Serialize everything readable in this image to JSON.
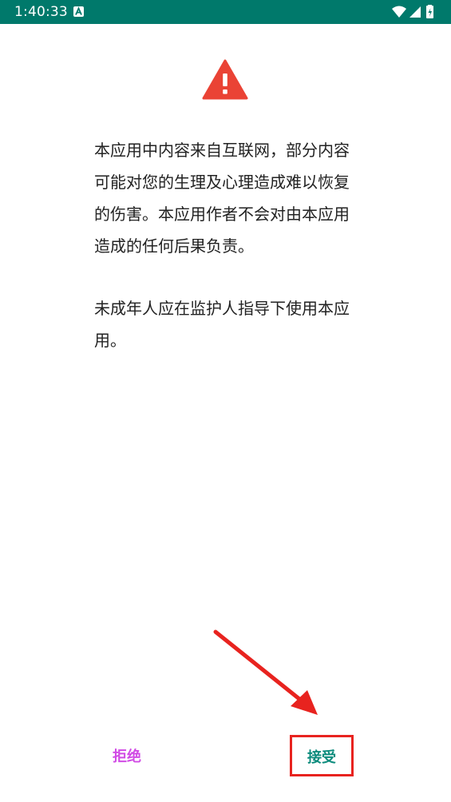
{
  "status_bar": {
    "time": "1:40:33",
    "app_icon": "a-letter-icon",
    "icons": [
      "wifi-icon",
      "signal-icon",
      "battery-charging-icon"
    ],
    "background_color": "#00796b"
  },
  "warning": {
    "icon": "warning-triangle-icon",
    "color": "#ea4335"
  },
  "message": {
    "paragraph1_lines": [
      "本应用中内容来自互联网，部分内容",
      "可能对您的生理及心理造成难以恢复",
      "的伤害。本应用作者不会对由本应用",
      "造成的任何后果负责。"
    ],
    "paragraph2_lines": [
      "未成年人应在监护人指导下使用本应",
      "用。"
    ]
  },
  "buttons": {
    "reject_label": "拒绝",
    "accept_label": "接受",
    "reject_color": "#d14be5",
    "accept_color": "#0b8b7c"
  },
  "annotation": {
    "arrow": "red-arrow-icon",
    "highlight_color": "#e8231f"
  }
}
